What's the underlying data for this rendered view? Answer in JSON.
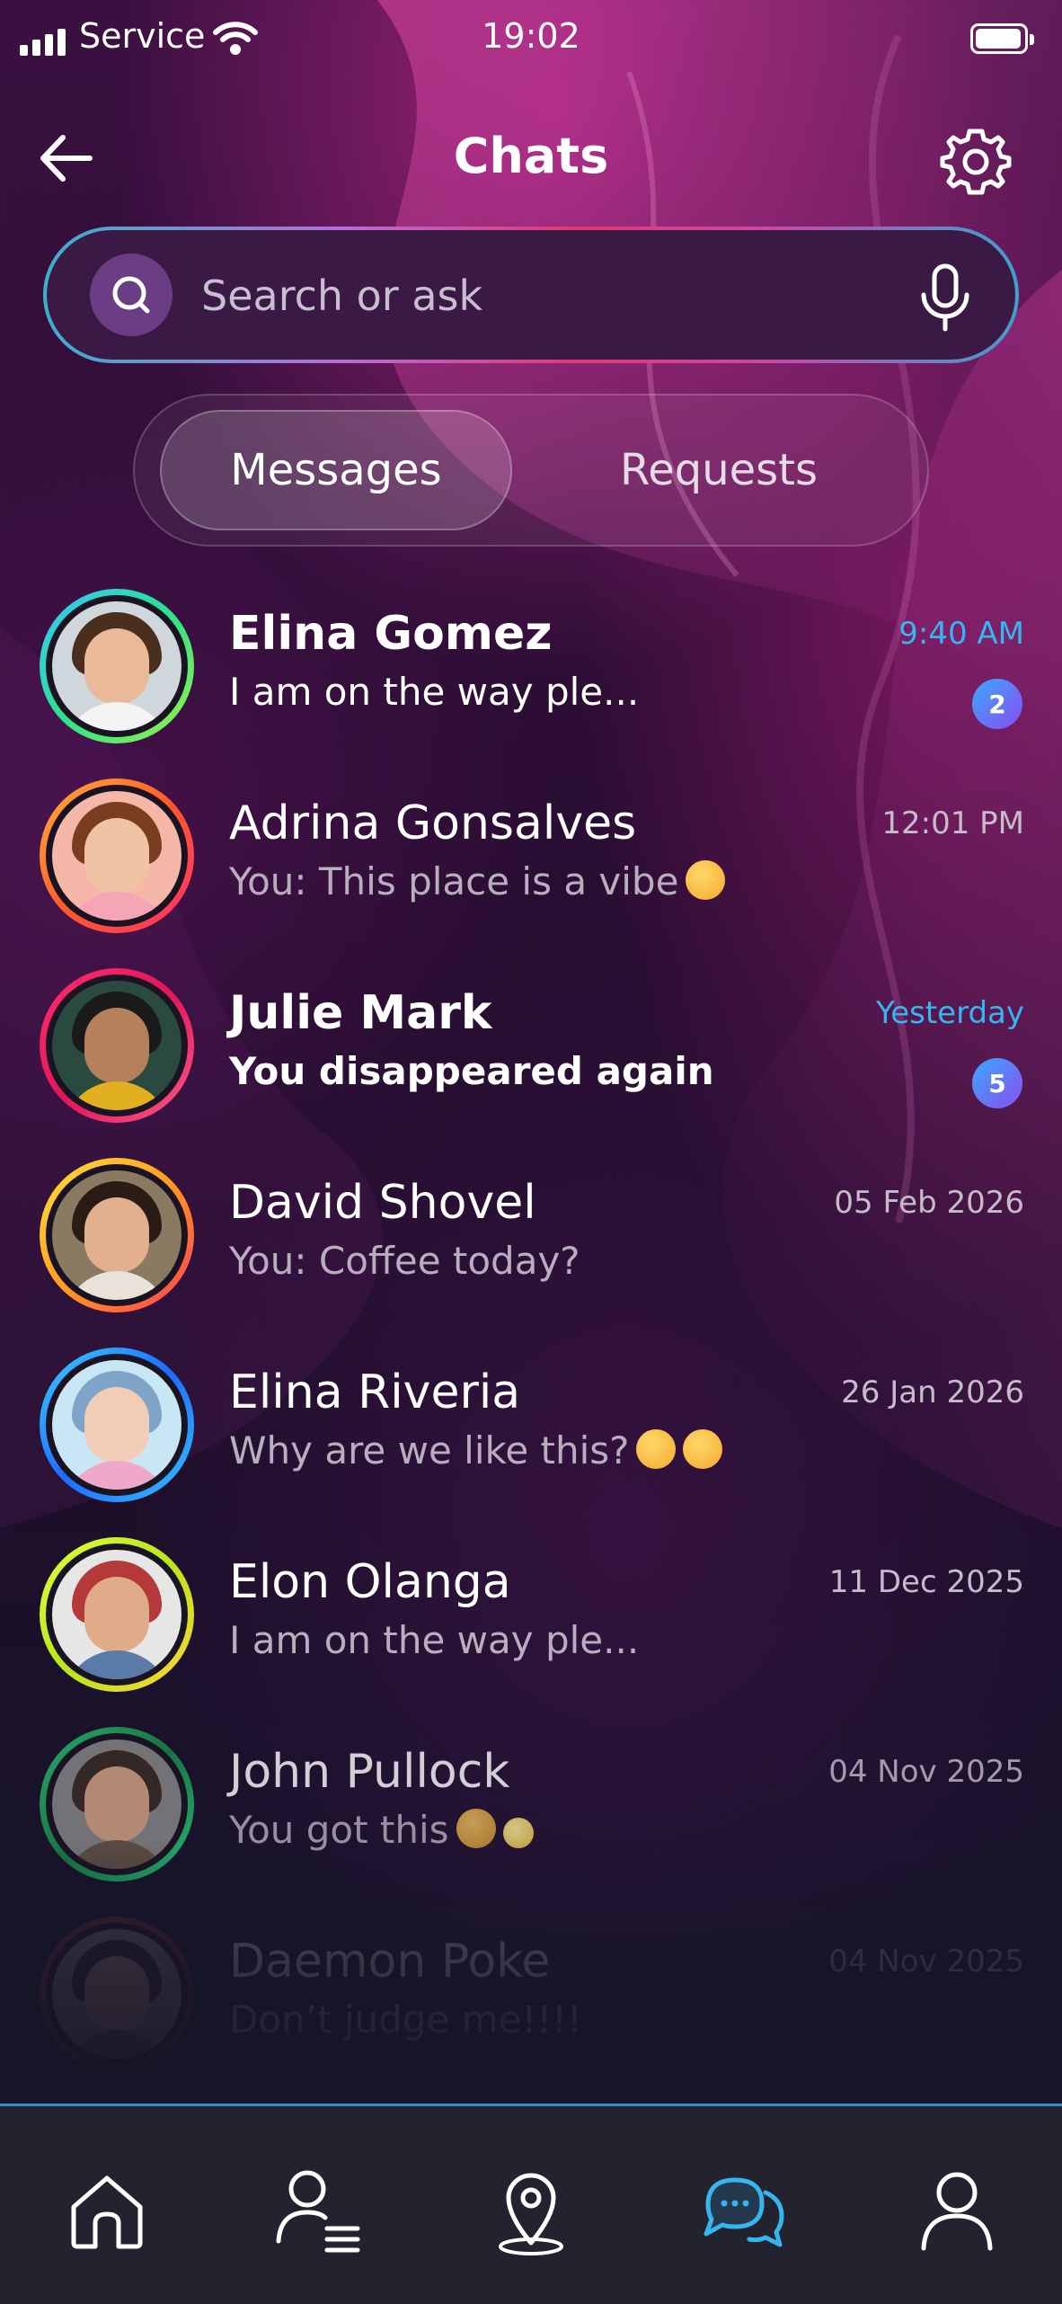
{
  "status_bar": {
    "carrier": "Service",
    "time": "19:02"
  },
  "header": {
    "title": "Chats"
  },
  "search": {
    "placeholder": "Search or ask"
  },
  "tabs": [
    {
      "label": "Messages",
      "active": true
    },
    {
      "label": "Requests",
      "active": false
    }
  ],
  "chats": [
    {
      "name": "Elina Gomez",
      "message": "I am on the way ple...",
      "time": "9:40 AM",
      "badge": "2",
      "unread": true,
      "ring": "#2be38a"
    },
    {
      "name": "Adrina Gonsalves",
      "message": "You: This place is a vibe",
      "emoji": "heart-eyes",
      "time": "12:01 PM",
      "unread": false,
      "ring": "#ff6a3d"
    },
    {
      "name": "Julie Mark",
      "message": "You disappeared again",
      "time": "Yesterday",
      "badge": "5",
      "unread": true,
      "ring": "#ff2f6d"
    },
    {
      "name": "David Shovel",
      "message": "You: Coffee today?",
      "time": "05 Feb 2026",
      "unread": false,
      "ring": "#ffb020"
    },
    {
      "name": "Elina Riveria",
      "message": "Why are we like this?",
      "emoji": "crying-laughing",
      "time": "26 Jan 2026",
      "unread": false,
      "ring": "#1e90ff"
    },
    {
      "name": "Elon Olanga",
      "message": "I am on the way ple...",
      "time": "11 Dec 2025",
      "unread": false,
      "ring": "#c8f020"
    },
    {
      "name": "John Pullock",
      "message": "You got this",
      "emoji": "flexed-biceps-sparkles",
      "time": "04 Nov 2025",
      "unread": false,
      "ring": "#1fa85a"
    },
    {
      "name": "Daemon Poke",
      "message": "Don’t judge me!!!!",
      "time": "04 Nov 2025",
      "unread": false,
      "ring": "#7a3a3a"
    }
  ],
  "nav": [
    {
      "icon": "home-icon",
      "active": false
    },
    {
      "icon": "contacts-list-icon",
      "active": false
    },
    {
      "icon": "location-pin-icon",
      "active": false
    },
    {
      "icon": "chat-bubbles-icon",
      "active": true
    },
    {
      "icon": "profile-icon",
      "active": false
    }
  ],
  "colors": {
    "accent": "#36b6f0",
    "badge": "#6a6cf5",
    "nav_bg": "#23232f"
  }
}
